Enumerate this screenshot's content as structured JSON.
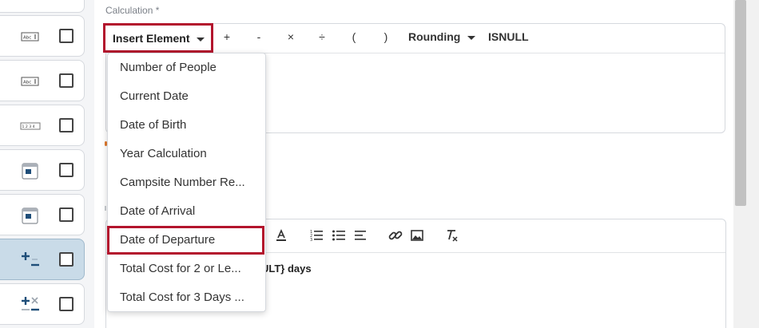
{
  "calculation": {
    "label": "Calculation *",
    "insert_element": "Insert Element",
    "operators": [
      "+",
      "-",
      "×",
      "÷",
      "(",
      ")"
    ],
    "rounding": "Rounding",
    "isnull": "ISNULL"
  },
  "dropdown": {
    "items": [
      "Number of People",
      "Current Date",
      "Date of Birth",
      "Year Calculation",
      "Campsite Number Re...",
      "Date of Arrival",
      "Date of Departure",
      "Total Cost for 2 or Le...",
      "Total Cost for 3 Days ..."
    ],
    "highlighted_index": 6
  },
  "left_fields": [
    {
      "icon": "text-field-icon",
      "selected": false
    },
    {
      "icon": "text-field-icon",
      "selected": false
    },
    {
      "icon": "number-field-icon",
      "selected": false
    },
    {
      "icon": "calendar-icon",
      "selected": false
    },
    {
      "icon": "calendar-icon",
      "selected": false
    },
    {
      "icon": "calculation-icon",
      "selected": true
    },
    {
      "icon": "calculation-icon",
      "selected": false
    }
  ],
  "left_icon_labels": {
    "text": "Abc",
    "number": "1 2 3 4"
  },
  "rich_text": {
    "content_fragment": "ULT} days"
  },
  "colors": {
    "highlight_border": "#b3142d",
    "selected_row": "#c9dbe8",
    "icon_dark_blue": "#1f4e79"
  }
}
